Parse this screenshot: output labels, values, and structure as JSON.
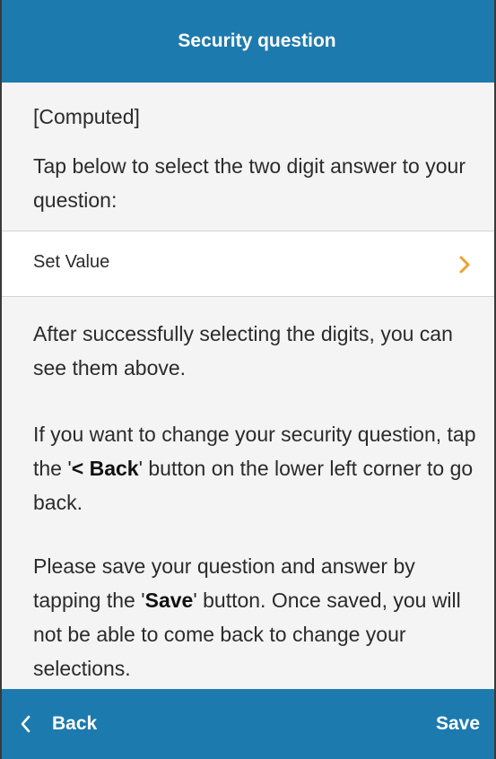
{
  "header": {
    "title": "Security question"
  },
  "content": {
    "computed": "[Computed]",
    "instruction": "Tap below to select the two digit answer to your question:",
    "set_value_label": "Set Value",
    "para1": "After successfully selecting the digits, you can see them above.",
    "para2": {
      "before": "If you want to change your security question, tap the '",
      "bold": "< Back",
      "after": "' button on the lower left corner to go back."
    },
    "para3": {
      "before": "Please save your question and answer by tapping the '",
      "bold": "Save",
      "after": "' button. Once saved, you will not be able to come back to change your selections."
    }
  },
  "footer": {
    "back_label": "Back",
    "save_label": "Save"
  },
  "icons": {
    "back": "chevron-left-icon",
    "set_value": "chevron-right-icon"
  },
  "colors": {
    "accent": "#1d7aae",
    "chevron": "#f0a030",
    "background": "#f4f4f4",
    "text": "#2b2b2b"
  }
}
